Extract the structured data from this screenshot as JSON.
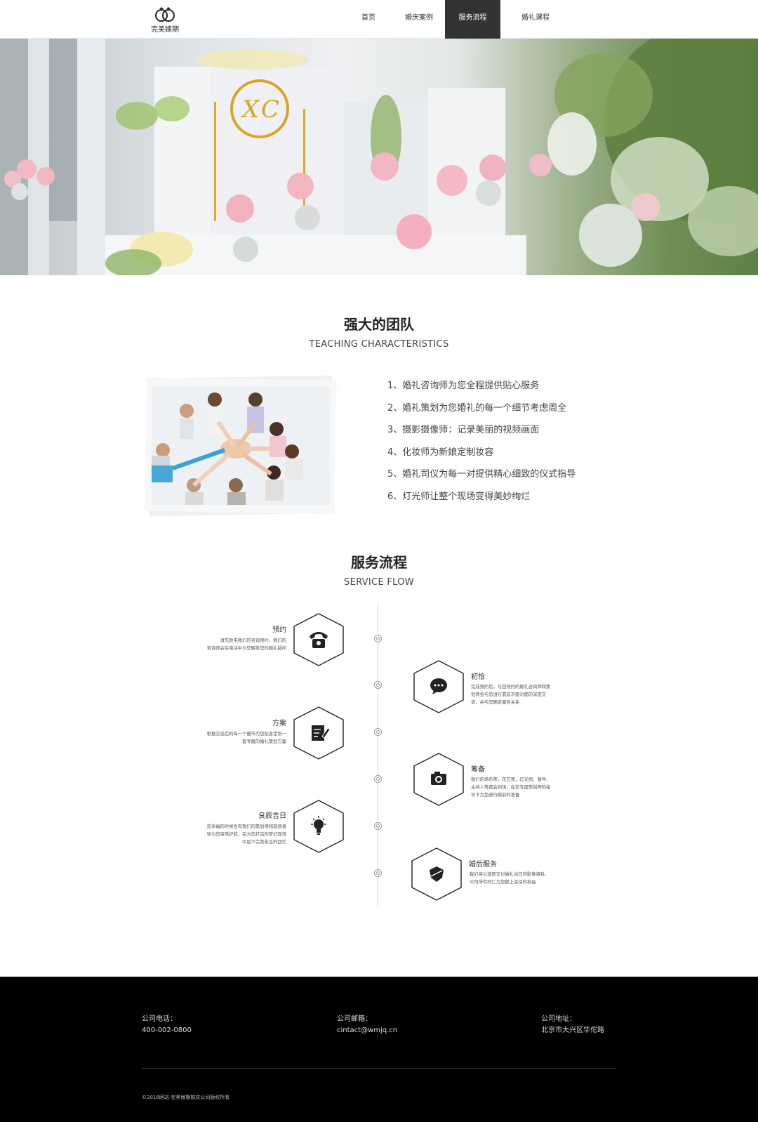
{
  "header": {
    "logo_text": "完美嫁期",
    "nav": [
      {
        "label": "首页",
        "active": false
      },
      {
        "label": "婚庆案例",
        "active": false
      },
      {
        "label": "服务流程",
        "active": true
      },
      {
        "label": "婚礼课程",
        "active": false
      }
    ]
  },
  "team": {
    "title": "强大的团队",
    "subtitle": "TEACHING CHARACTERISTICS",
    "items": [
      "1、婚礼咨询师为您全程提供贴心服务",
      "2、婚礼策划为您婚礼的每一个细节考虑周全",
      "3、摄影摄像师：记录美丽的视频画面",
      "4、化妆师为新娘定制妆容",
      "5、婚礼司仪为每一对提供精心细致的仪式指导",
      "6、灯光师让整个现场变得美妙绚烂"
    ]
  },
  "flow": {
    "title": "服务流程",
    "subtitle": "SERVICE FLOW",
    "steps": [
      {
        "title": "预约",
        "icon": "telephone-icon",
        "side": "left",
        "desc": [
          "请先致电我们的咨询预约，我们的",
          "咨询师会在电话中为您解答您的婚礼疑问"
        ]
      },
      {
        "title": "初恰",
        "icon": "chat-bubble-icon",
        "side": "right",
        "desc": [
          "完成预约后，与您预约的婚礼咨询师和策",
          "划师会与您进行靠前次面对面的深度交",
          "流，并与您确定服务关系"
        ]
      },
      {
        "title": "方案",
        "icon": "document-edit-icon",
        "side": "left",
        "desc": [
          "根据交谈后的每一个细节为您贴身定制一",
          "套专属的婚礼策划方案"
        ]
      },
      {
        "title": "筹备",
        "icon": "camera-icon",
        "side": "right",
        "desc": [
          "我们的场布师，花艺师，灯光师，督导，",
          "主持人等都会到场，在您专属策划师的指",
          "导下为您进行婚前的准备"
        ]
      },
      {
        "title": "良辰吉日",
        "icon": "lightbulb-icon",
        "side": "left",
        "desc": [
          "您幸福的时候会有我们的策划师和现场督",
          "导为您保驾护航，在为您打造的梦幻现场",
          "中留下完美永生的回忆"
        ]
      },
      {
        "title": "婚后服务",
        "icon": "shield-icon",
        "side": "right",
        "desc": [
          "我们将以速度交付婚礼当日的影像资料，",
          "公司所有同仁为您献上深深的祝福"
        ]
      }
    ]
  },
  "footer": {
    "phone_label": "公司电话：",
    "phone": "400-002-0800",
    "email_label": "公司邮箱：",
    "email": "cintact@wmjq.cn",
    "address_label": "公司地址：",
    "address": "北京市大兴区华佗路",
    "copyright": "©2018网站-完美嫁期婚庆公司版权所有"
  }
}
